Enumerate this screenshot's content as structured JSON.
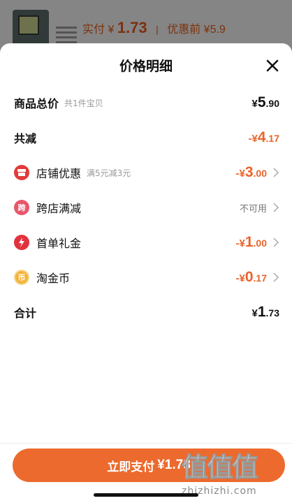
{
  "background": {
    "paid_label": "实付",
    "paid_currency": "¥",
    "paid_amount": "1.73",
    "before_label": "优惠前",
    "before_amount": "¥5.9"
  },
  "sheet": {
    "title": "价格明细"
  },
  "rows": {
    "total": {
      "label": "商品总价",
      "sub": "共1件宝贝",
      "cur": "¥",
      "int": "5",
      "dec": ".90"
    },
    "reduce": {
      "label": "共减",
      "cur": "-¥",
      "int": "4",
      "dec": ".17"
    },
    "store": {
      "label": "店铺优惠",
      "sub": "满5元减3元",
      "cur": "-¥",
      "int": "3",
      "dec": ".00",
      "icon_char": ""
    },
    "cross": {
      "label": "跨店满减",
      "icon_char": "跨",
      "status": "不可用"
    },
    "first": {
      "label": "首单礼金",
      "cur": "-¥",
      "int": "1",
      "dec": ".00"
    },
    "coin": {
      "label": "淘金币",
      "icon_char": "币",
      "cur": "-¥",
      "int": "0",
      "dec": ".17"
    },
    "sum": {
      "label": "合计",
      "cur": "¥",
      "int": "1",
      "dec": ".73"
    }
  },
  "pay_button": {
    "label": "立即支付",
    "amount": "¥1.73"
  },
  "watermark": {
    "chars": "值值值",
    "url": "zhizhizhi.com"
  },
  "colors": {
    "accent": "#ec6a2e",
    "discount": "#e8642a"
  }
}
